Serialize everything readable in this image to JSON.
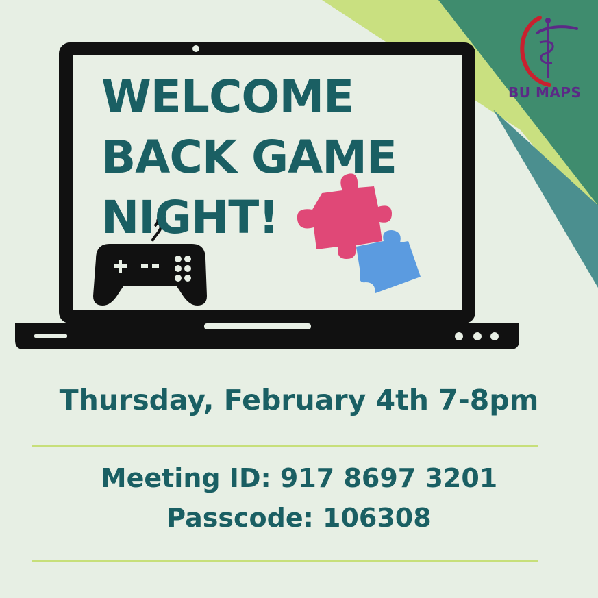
{
  "logo": {
    "text": "BU MAPS"
  },
  "headline": {
    "line1": "WELCOME",
    "line2": "BACK GAME",
    "line3": "NIGHT!"
  },
  "event": {
    "date_time": "Thursday, February 4th 7-8pm",
    "meeting_id": "Meeting ID: 917 8697 3201",
    "passcode": "Passcode: 106308"
  },
  "colors": {
    "background": "#e7efe4",
    "heading": "#1a5f63",
    "accent_lime": "#c7df7a",
    "accent_green": "#3f8c6e",
    "accent_teal": "#4b8f8f",
    "puzzle_pink": "#e04877",
    "puzzle_blue": "#5b9be0",
    "logo_purple": "#5b2a86",
    "logo_red": "#c8212f"
  },
  "icons": [
    "game-controller-icon",
    "puzzle-piece-icon",
    "caduceus-logo-icon"
  ]
}
